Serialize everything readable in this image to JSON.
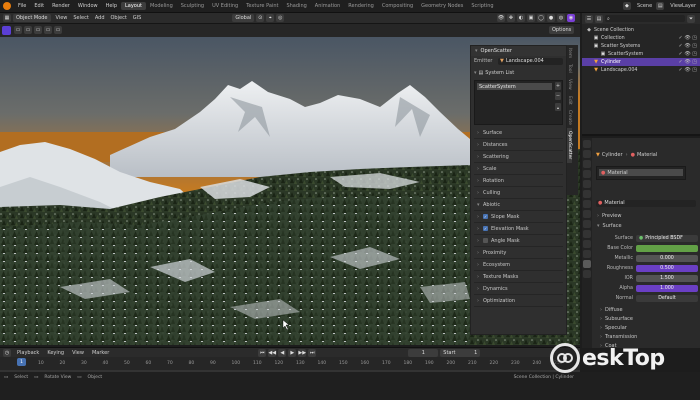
{
  "menu": {
    "items": [
      "File",
      "Edit",
      "Render",
      "Window",
      "Help"
    ],
    "workspaces": [
      "Layout",
      "Modeling",
      "Sculpting",
      "UV Editing",
      "Texture Paint",
      "Shading",
      "Animation",
      "Rendering",
      "Compositing",
      "Geometry Nodes",
      "Scripting"
    ],
    "active_workspace": "Layout",
    "scene_label": "Scene",
    "view_layer_label": "ViewLayer"
  },
  "viewport_header": {
    "mode": "Object Mode",
    "menus": [
      "View",
      "Select",
      "Add",
      "Object",
      "GIS"
    ],
    "orientation": "Global",
    "options_label": "Options"
  },
  "npanel": {
    "title": "OpenScatter",
    "emitter_label": "Emitter",
    "emitter_value": "Landscape.004",
    "system_list_label": "System List",
    "system_item": "ScatterSystem",
    "sections": [
      {
        "label": "Surface",
        "check": null
      },
      {
        "label": "Distances",
        "check": null
      },
      {
        "label": "Scattering",
        "check": null
      },
      {
        "label": "Scale",
        "check": null
      },
      {
        "label": "Rotation",
        "check": null
      },
      {
        "label": "Culling",
        "check": null
      },
      {
        "label": "Abiotic",
        "check": null,
        "open": true
      },
      {
        "label": "Slope Mask",
        "check": true
      },
      {
        "label": "Elevation Mask",
        "check": true
      },
      {
        "label": "Angle Mask",
        "check": false
      },
      {
        "label": "Proximity",
        "check": null
      },
      {
        "label": "Ecosystem",
        "check": null
      },
      {
        "label": "Texture Masks",
        "check": null
      },
      {
        "label": "Dynamics",
        "check": null
      },
      {
        "label": "Optimization",
        "check": null
      }
    ],
    "tabs": [
      "Item",
      "Tool",
      "View",
      "Edit",
      "Create",
      "OpenScatter"
    ],
    "active_tab": "OpenScatter"
  },
  "outliner": {
    "rows": [
      {
        "label": "Scene Collection",
        "indent": 0,
        "state": "",
        "icon": "scene-icon"
      },
      {
        "label": "Collection",
        "indent": 1,
        "state": "",
        "icon": "collection-icon"
      },
      {
        "label": "Scatter Systems",
        "indent": 1,
        "state": "",
        "icon": "collection-icon"
      },
      {
        "label": "ScatterSystem",
        "indent": 2,
        "state": "",
        "icon": "collection-icon"
      },
      {
        "label": "Cylinder",
        "indent": 1,
        "state": "active",
        "icon": "mesh-icon"
      },
      {
        "label": "Landscape.004",
        "indent": 1,
        "state": "",
        "icon": "mesh-icon"
      }
    ]
  },
  "properties": {
    "object_name": "Cylinder",
    "material_tab": "Material",
    "slot": "Material",
    "material_name": "Material",
    "preview": "Preview",
    "surface_section": "Surface",
    "surface_label": "Surface",
    "surface_value": "Principled BSDF",
    "fields": [
      {
        "label": "Base Color",
        "value": "",
        "color": "#62a046"
      },
      {
        "label": "Metallic",
        "value": "0.000",
        "color": "#545454"
      },
      {
        "label": "Roughness",
        "value": "0.500",
        "color": "#6a3fc4"
      },
      {
        "label": "IOR",
        "value": "1.500",
        "color": "#545454"
      },
      {
        "label": "Alpha",
        "value": "1.000",
        "color": "#6a3fc4"
      },
      {
        "label": "Normal",
        "value": "Default",
        "color": "#3a3a3a"
      }
    ],
    "subsections": [
      "Diffuse",
      "Subsurface",
      "Specular",
      "Transmission",
      "Coat"
    ]
  },
  "timeline": {
    "menus": [
      "Playback",
      "Keying",
      "View",
      "Marker"
    ],
    "current_frame": "1",
    "start_label": "Start",
    "start_value": "1",
    "ticks": [
      "10",
      "20",
      "30",
      "40",
      "50",
      "60",
      "70",
      "80",
      "90",
      "100",
      "110",
      "120",
      "130",
      "140",
      "150",
      "160",
      "170",
      "180",
      "190",
      "200",
      "210",
      "220",
      "230",
      "240",
      "250"
    ]
  },
  "statusbar": {
    "items": [
      "Select",
      "Rotate View",
      "Object"
    ],
    "right": "Scene Collection | Cylinder"
  },
  "watermark": {
    "text": "eskTop"
  },
  "colors": {
    "accent_blue": "#4772b3",
    "accent_purple": "#7a3fd6",
    "blender_orange": "#e87d0d"
  }
}
